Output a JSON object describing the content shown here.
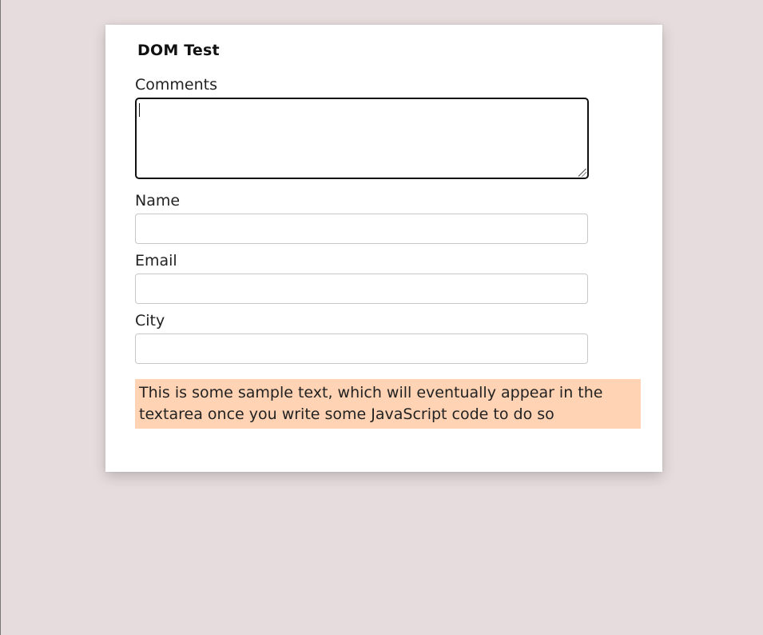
{
  "page": {
    "title": "DOM Test"
  },
  "form": {
    "comments_label": "Comments",
    "comments_value": "",
    "name_label": "Name",
    "name_value": "",
    "email_label": "Email",
    "email_value": "",
    "city_label": "City",
    "city_value": ""
  },
  "sample": {
    "text": "This is some sample text, which will eventually appear in the textarea once you write some JavaScript code to do so"
  },
  "colors": {
    "page_background": "#e6dcdd",
    "card_background": "#ffffff",
    "sample_background": "#ffd3b4"
  }
}
